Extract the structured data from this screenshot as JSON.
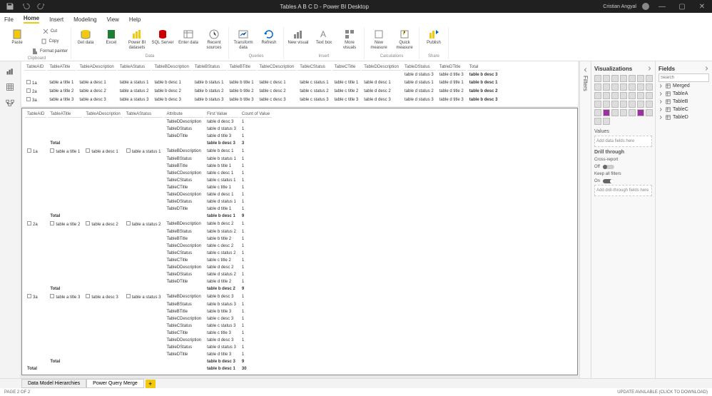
{
  "titlebar": {
    "title": "Tables A B C D - Power BI Desktop",
    "user": "Cristian Angyal"
  },
  "menu": {
    "file": "File",
    "home": "Home",
    "insert": "Insert",
    "modeling": "Modeling",
    "view": "View",
    "help": "Help"
  },
  "ribbon": {
    "clipboard": {
      "paste": "Paste",
      "cut": "Cut",
      "copy": "Copy",
      "fp": "Format painter",
      "label": "Clipboard"
    },
    "data": {
      "get": "Get\ndata",
      "excel": "Excel",
      "pbi": "Power BI\ndatasets",
      "sql": "SQL\nServer",
      "enter": "Enter\ndata",
      "recent": "Recent\nsources",
      "label": "Data"
    },
    "queries": {
      "transform": "Transform\ndata",
      "refresh": "Refresh",
      "label": "Queries"
    },
    "insert": {
      "nv": "New\nvisual",
      "tb": "Text\nbox",
      "mv": "More\nvisuals",
      "label": "Insert"
    },
    "calc": {
      "nm": "New\nmeasure",
      "qm": "Quick\nmeasure",
      "label": "Calculations"
    },
    "share": {
      "pub": "Publish",
      "label": "Share"
    }
  },
  "mat1": {
    "headers": [
      "TableAID",
      "TableATitle",
      "TableADescription",
      "TableAStatus",
      "TableBDescription",
      "TableBStatus",
      "TableBTitle",
      "TableCDescription",
      "TableCStatus",
      "TableCTitle",
      "TableDDescription",
      "TableDStatus",
      "TableDTitle",
      "Total"
    ],
    "rows": [
      [
        "",
        "",
        "",
        "",
        "",
        "",
        "",
        "",
        "",
        "",
        "",
        "table d status 3",
        "table d title 3",
        "table b desc 3"
      ],
      [
        "1a",
        "table a title 1",
        "table a desc 1",
        "table a status 1",
        "table b desc 1",
        "table b status 1",
        "table b title 1",
        "table c desc 1",
        "table c status 1",
        "table c title 1",
        "table d desc 1",
        "table d status 1",
        "table d title 1",
        "table b desc 1"
      ],
      [
        "2a",
        "table a title 2",
        "table a desc 2",
        "table a status 2",
        "table b desc 2",
        "table b status 2",
        "table b title 2",
        "table c desc 2",
        "table c status 2",
        "table c title 2",
        "table d desc 2",
        "table d status 2",
        "table d title 2",
        "table b desc 2"
      ],
      [
        "3a",
        "table a title 3",
        "table a desc 3",
        "table a status 3",
        "table b desc 3",
        "table b status 3",
        "table b title 3",
        "table c desc 3",
        "table c status 3",
        "table c title 3",
        "table d desc 3",
        "table d status 3",
        "table d title 3",
        "table b desc 3"
      ]
    ]
  },
  "mat2": {
    "headers": [
      "TableAID",
      "TableATitle",
      "TableADescription",
      "TableAStatus",
      "Attribute",
      "First Value",
      "Count of Value"
    ],
    "groups": [
      {
        "key": [
          "",
          "",
          "",
          "",
          ""
        ],
        "rows": [
          [
            "TableDDescription",
            "table d desc 3",
            "1"
          ],
          [
            "TableDStatus",
            "table d status 3",
            "1"
          ],
          [
            "TableDTitle",
            "table d title 3",
            "1"
          ]
        ],
        "total": [
          "Total",
          "",
          "",
          "",
          "",
          "table b desc 3",
          "3"
        ]
      },
      {
        "key": [
          "1a",
          "table a title 1",
          "table a desc 1",
          "table a status 1"
        ],
        "rows": [
          [
            "TableBDescription",
            "table b desc 1",
            "1"
          ],
          [
            "TableBStatus",
            "table b status 1",
            "1"
          ],
          [
            "TableBTitle",
            "table b title 1",
            "1"
          ],
          [
            "TableCDescription",
            "table c desc 1",
            "1"
          ],
          [
            "TableCStatus",
            "table c status 1",
            "1"
          ],
          [
            "TableCTitle",
            "table c title 1",
            "1"
          ],
          [
            "TableDDescription",
            "table d desc 1",
            "1"
          ],
          [
            "TableDStatus",
            "table d status 1",
            "1"
          ],
          [
            "TableDTitle",
            "table d title 1",
            "1"
          ]
        ],
        "total": [
          "Total",
          "",
          "",
          "",
          "",
          "table b desc 1",
          "9"
        ]
      },
      {
        "key": [
          "2a",
          "table a title 2",
          "table a desc 2",
          "table a status 2"
        ],
        "rows": [
          [
            "TableBDescription",
            "table b desc 2",
            "1"
          ],
          [
            "TableBStatus",
            "table b status 2",
            "1"
          ],
          [
            "TableBTitle",
            "table b title 2",
            "1"
          ],
          [
            "TableCDescription",
            "table c desc 2",
            "1"
          ],
          [
            "TableCStatus",
            "table c status 2",
            "1"
          ],
          [
            "TableCTitle",
            "table c title 2",
            "1"
          ],
          [
            "TableDDescription",
            "table d desc 2",
            "1"
          ],
          [
            "TableDStatus",
            "table d status 2",
            "1"
          ],
          [
            "TableDTitle",
            "table d title 2",
            "1"
          ]
        ],
        "total": [
          "Total",
          "",
          "",
          "",
          "",
          "table b desc 2",
          "9"
        ]
      },
      {
        "key": [
          "3a",
          "table a title 3",
          "table a desc 3",
          "table a status 3"
        ],
        "rows": [
          [
            "TableBDescription",
            "table b desc 3",
            "1"
          ],
          [
            "TableBStatus",
            "table b status 3",
            "1"
          ],
          [
            "TableBTitle",
            "table b title 3",
            "1"
          ],
          [
            "TableCDescription",
            "table c desc 3",
            "1"
          ],
          [
            "TableCStatus",
            "table c status 3",
            "1"
          ],
          [
            "TableCTitle",
            "table c title 3",
            "1"
          ],
          [
            "TableDDescription",
            "table d desc 3",
            "1"
          ],
          [
            "TableDStatus",
            "table d status 3",
            "1"
          ],
          [
            "TableDTitle",
            "table d title 3",
            "1"
          ]
        ],
        "total": [
          "Total",
          "",
          "",
          "",
          "",
          "table b desc 3",
          "9"
        ]
      }
    ],
    "grand": [
      "Total",
      "",
      "",
      "",
      "",
      "table b desc 1",
      "30"
    ]
  },
  "viz": {
    "title": "Visualizations",
    "values": "Values",
    "drop": "Add data fields here",
    "drill": "Drill through",
    "cross": "Cross-report",
    "off": "Off",
    "keep": "Keep all filters",
    "on": "On",
    "drilldrop": "Add drill-through fields here"
  },
  "fields": {
    "title": "Fields",
    "search": "Search",
    "tables": [
      "Merged",
      "TableA",
      "TableB",
      "TableC",
      "TableD"
    ]
  },
  "filters": {
    "title": "Filters"
  },
  "tabs": {
    "t1": "Data Model Hierarchies",
    "t2": "Power Query Merge"
  },
  "status": {
    "page": "PAGE 2 OF 2",
    "upd": "UPDATE AVAILABLE (CLICK TO DOWNLOAD)"
  }
}
